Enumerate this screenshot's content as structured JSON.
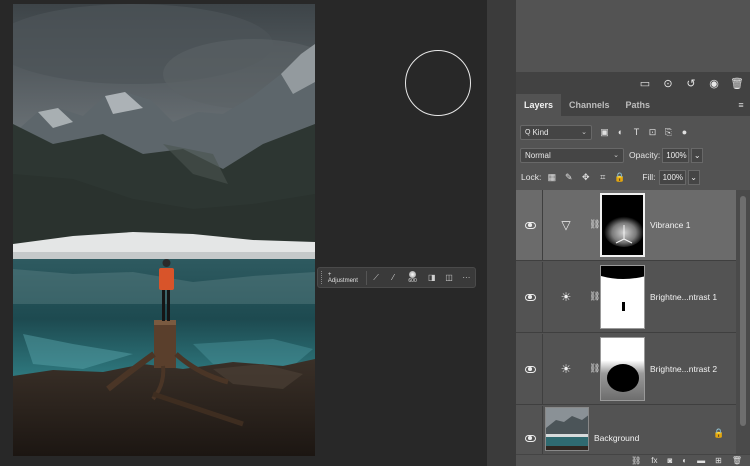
{
  "canvas": {
    "task_bar": {
      "adjustment_label": "+ Adjustment",
      "brush_size": "600",
      "more_label": "···"
    }
  },
  "history_toolbar": {
    "icons": [
      "new-snapshot-icon",
      "document-from-state-icon",
      "undo-icon",
      "visibility-icon",
      "trash-icon"
    ]
  },
  "layers_panel": {
    "tabs": [
      {
        "label": "Layers",
        "active": true
      },
      {
        "label": "Channels",
        "active": false
      },
      {
        "label": "Paths",
        "active": false
      }
    ],
    "filter": {
      "label": "Kind",
      "prefix": "Q"
    },
    "blend_mode": "Normal",
    "opacity_label": "Opacity:",
    "opacity_value": "100%",
    "lock_label": "Lock:",
    "fill_label": "Fill:",
    "fill_value": "100%",
    "layers": [
      {
        "name": "Vibrance 1",
        "type": "vibrance",
        "selected": true
      },
      {
        "name": "Brightne...ntrast 1",
        "type": "brightness-contrast",
        "selected": false
      },
      {
        "name": "Brightne...ntrast 2",
        "type": "brightness-contrast",
        "selected": false
      },
      {
        "name": "Background",
        "type": "background",
        "selected": false
      }
    ]
  },
  "bottom_bar": {
    "icons": [
      "link-icon",
      "fx-icon",
      "mask-icon",
      "adjustment-icon",
      "group-icon",
      "new-layer-icon",
      "trash-icon"
    ],
    "fx_label": "fx"
  },
  "colors": {
    "canvas_bg": "#282828",
    "panel_bg": "#535353",
    "selected_layer": "#6b6b6b"
  }
}
